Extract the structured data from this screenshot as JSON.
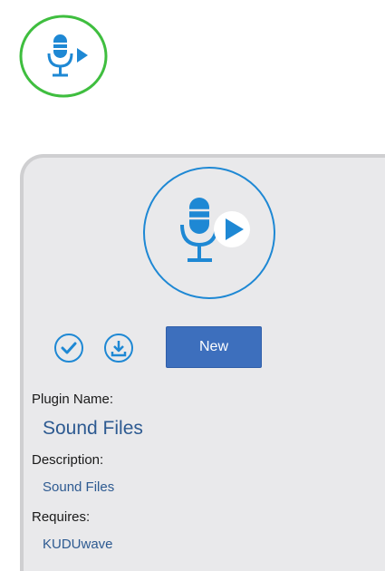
{
  "plugin": {
    "name_label": "Plugin Name:",
    "name": "Sound Files",
    "description_label": "Description:",
    "description": "Sound Files",
    "requires_label": "Requires:",
    "requires": "KUDUwave"
  },
  "actions": {
    "new_label": "New",
    "approve_icon": "check-circle-icon",
    "download_icon": "download-circle-icon"
  },
  "icons": {
    "top": "microphone-play-icon",
    "card": "microphone-play-icon"
  },
  "colors": {
    "installed_ring": "#3fbe3f",
    "accent": "#1e88d4",
    "button": "#3d6fbd",
    "value_text": "#2d5a91",
    "card_bg": "#e9e9eb"
  }
}
